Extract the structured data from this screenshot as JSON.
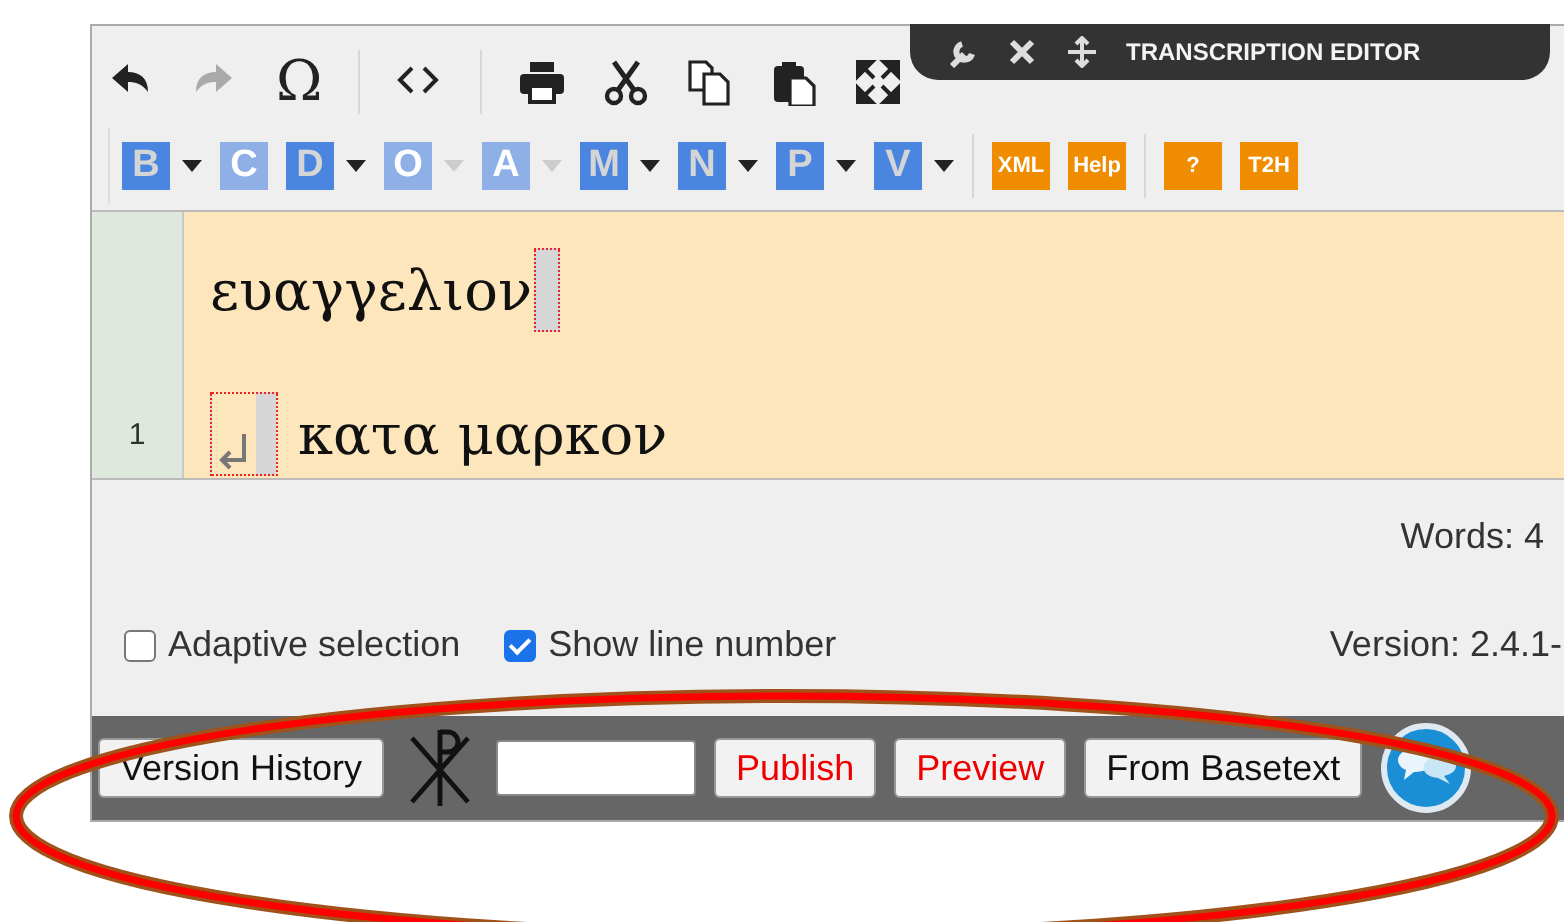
{
  "header": {
    "title": "TRANSCRIPTION EDITOR",
    "tools": [
      {
        "kind": "wrench"
      },
      {
        "kind": "close"
      },
      {
        "kind": "move"
      }
    ]
  },
  "toolbar": {
    "row_1": [
      {
        "kind": "undo",
        "disabled": false
      },
      {
        "kind": "redo",
        "disabled": true
      },
      {
        "kind": "symbol",
        "text": "Ω",
        "disabled": false
      },
      {
        "kind": "separator"
      },
      {
        "kind": "code",
        "disabled": false
      },
      {
        "kind": "separator"
      },
      {
        "kind": "print",
        "disabled": false
      },
      {
        "kind": "cut",
        "disabled": false
      },
      {
        "kind": "copy",
        "disabled": false
      },
      {
        "kind": "paste",
        "disabled": false
      },
      {
        "kind": "maximize",
        "disabled": false
      }
    ],
    "row_2": [
      {
        "kind": "letter",
        "label": "B",
        "disabled": false,
        "dropdown": true
      },
      {
        "kind": "letter",
        "label": "C",
        "disabled": true,
        "dropdown": false
      },
      {
        "kind": "letter",
        "label": "D",
        "disabled": false,
        "dropdown": true
      },
      {
        "kind": "letter",
        "label": "O",
        "disabled": true,
        "dropdown": true
      },
      {
        "kind": "letter",
        "label": "A",
        "disabled": true,
        "dropdown": true
      },
      {
        "kind": "letter",
        "label": "M",
        "disabled": false,
        "dropdown": true
      },
      {
        "kind": "letter",
        "label": "N",
        "disabled": false,
        "dropdown": true
      },
      {
        "kind": "letter",
        "label": "P",
        "disabled": false,
        "dropdown": true
      },
      {
        "kind": "letter",
        "label": "V",
        "disabled": false,
        "dropdown": true
      },
      {
        "kind": "separator"
      },
      {
        "kind": "tool",
        "label": "XML"
      },
      {
        "kind": "tool",
        "label": "Help"
      },
      {
        "kind": "separator"
      },
      {
        "kind": "tool",
        "label": "?"
      },
      {
        "kind": "tool",
        "label": "T2H"
      }
    ]
  },
  "editor": {
    "lines": [
      {
        "text": "ευαγγελιον",
        "break_before": false,
        "break_after": true
      },
      {
        "number": "1",
        "text": "κατα μαρκον",
        "break_before": true,
        "break_after": false
      }
    ]
  },
  "status": {
    "words": "Words: 4",
    "options": [
      {
        "label": "Adaptive selection",
        "checked": false
      },
      {
        "label": "Show line number",
        "checked": true
      }
    ],
    "version": "Version: 2.4.1-"
  },
  "bottom_bar": [
    {
      "kind": "button",
      "label": "Version History",
      "emphasis": false
    },
    {
      "kind": "logo"
    },
    {
      "kind": "field"
    },
    {
      "kind": "button",
      "label": "Publish",
      "emphasis": true
    },
    {
      "kind": "button",
      "label": "Preview",
      "emphasis": true
    },
    {
      "kind": "button",
      "label": "From Basetext",
      "emphasis": false
    },
    {
      "kind": "chat"
    }
  ],
  "highlight": {
    "kind": "ellipse"
  }
}
